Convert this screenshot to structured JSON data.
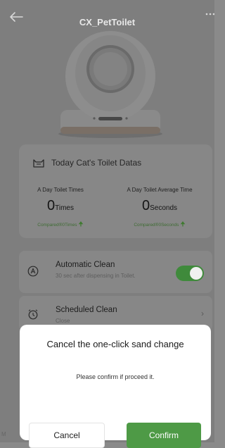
{
  "header": {
    "title": "CX_PetToilet"
  },
  "stats_card": {
    "title": "Today Cat's Toilet Datas",
    "times": {
      "label": "A Day Toilet Times",
      "value": "0",
      "unit": "Times",
      "compare": "Compared®0Times"
    },
    "average": {
      "label": "A Day Toilet Average Time",
      "value": "0",
      "unit": "Seconds",
      "compare": "Compared®0Seconds"
    }
  },
  "automatic_clean": {
    "title": "Automatic Clean",
    "subtitle": "30 sec after dispensing in Toilet.",
    "enabled": true
  },
  "scheduled_clean": {
    "title": "Scheduled Clean",
    "subtitle": "Close"
  },
  "dialog": {
    "title": "Cancel the one-click sand change",
    "message": "Please confirm if proceed it.",
    "cancel_label": "Cancel",
    "confirm_label": "Confirm"
  },
  "bottom_fragment": "M",
  "colors": {
    "accent": "#4e9a46",
    "overlay": "#7e7e7e"
  }
}
